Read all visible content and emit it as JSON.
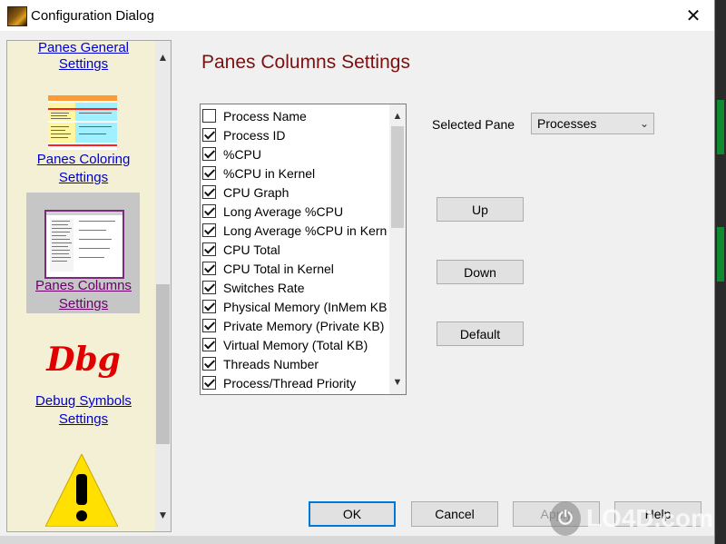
{
  "window": {
    "title": "Configuration Dialog",
    "close_glyph": "✕"
  },
  "sidebar": {
    "items": [
      {
        "label_line1": "Panes General",
        "label_line2": "Settings"
      },
      {
        "label_line1": "Panes Coloring",
        "label_line2": "Settings"
      },
      {
        "label_line1": "Panes Columns",
        "label_line2": "Settings",
        "selected": true
      },
      {
        "label_line1": "Debug Symbols",
        "label_line2": "Settings"
      }
    ],
    "dbg_logo_text": "Dbg",
    "scroll_up": "▲",
    "scroll_down": "▼"
  },
  "main": {
    "heading": "Panes Columns Settings",
    "columns": [
      {
        "label": "Process Name",
        "checked": false
      },
      {
        "label": "Process ID",
        "checked": true
      },
      {
        "label": "%CPU",
        "checked": true
      },
      {
        "label": "%CPU in Kernel",
        "checked": true
      },
      {
        "label": "CPU Graph",
        "checked": true
      },
      {
        "label": "Long Average %CPU",
        "checked": true
      },
      {
        "label": "Long Average %CPU in Kernel",
        "checked": true
      },
      {
        "label": "CPU Total",
        "checked": true
      },
      {
        "label": "CPU Total in Kernel",
        "checked": true
      },
      {
        "label": "Switches Rate",
        "checked": true
      },
      {
        "label": "Physical Memory (InMem KB)",
        "checked": true
      },
      {
        "label": "Private Memory (Private KB)",
        "checked": true
      },
      {
        "label": "Virtual Memory (Total KB)",
        "checked": true
      },
      {
        "label": "Threads Number",
        "checked": true
      },
      {
        "label": "Process/Thread Priority",
        "checked": true
      }
    ],
    "list_scroll_up": "▲",
    "list_scroll_down": "▼",
    "selected_pane_label": "Selected Pane",
    "selected_pane_value": "Processes",
    "select_arrow": "⌄",
    "up_label": "Up",
    "down_label": "Down",
    "default_label": "Default"
  },
  "footer": {
    "ok_label": "OK",
    "cancel_label": "Cancel",
    "apply_label": "Apply",
    "help_label": "Help"
  },
  "watermark": {
    "text": "LO4D.com"
  },
  "colors": {
    "heading": "#7a1010",
    "link": "#0000cc",
    "sidebar_bg": "#f3f0d6",
    "focus_border": "#0078d7"
  }
}
